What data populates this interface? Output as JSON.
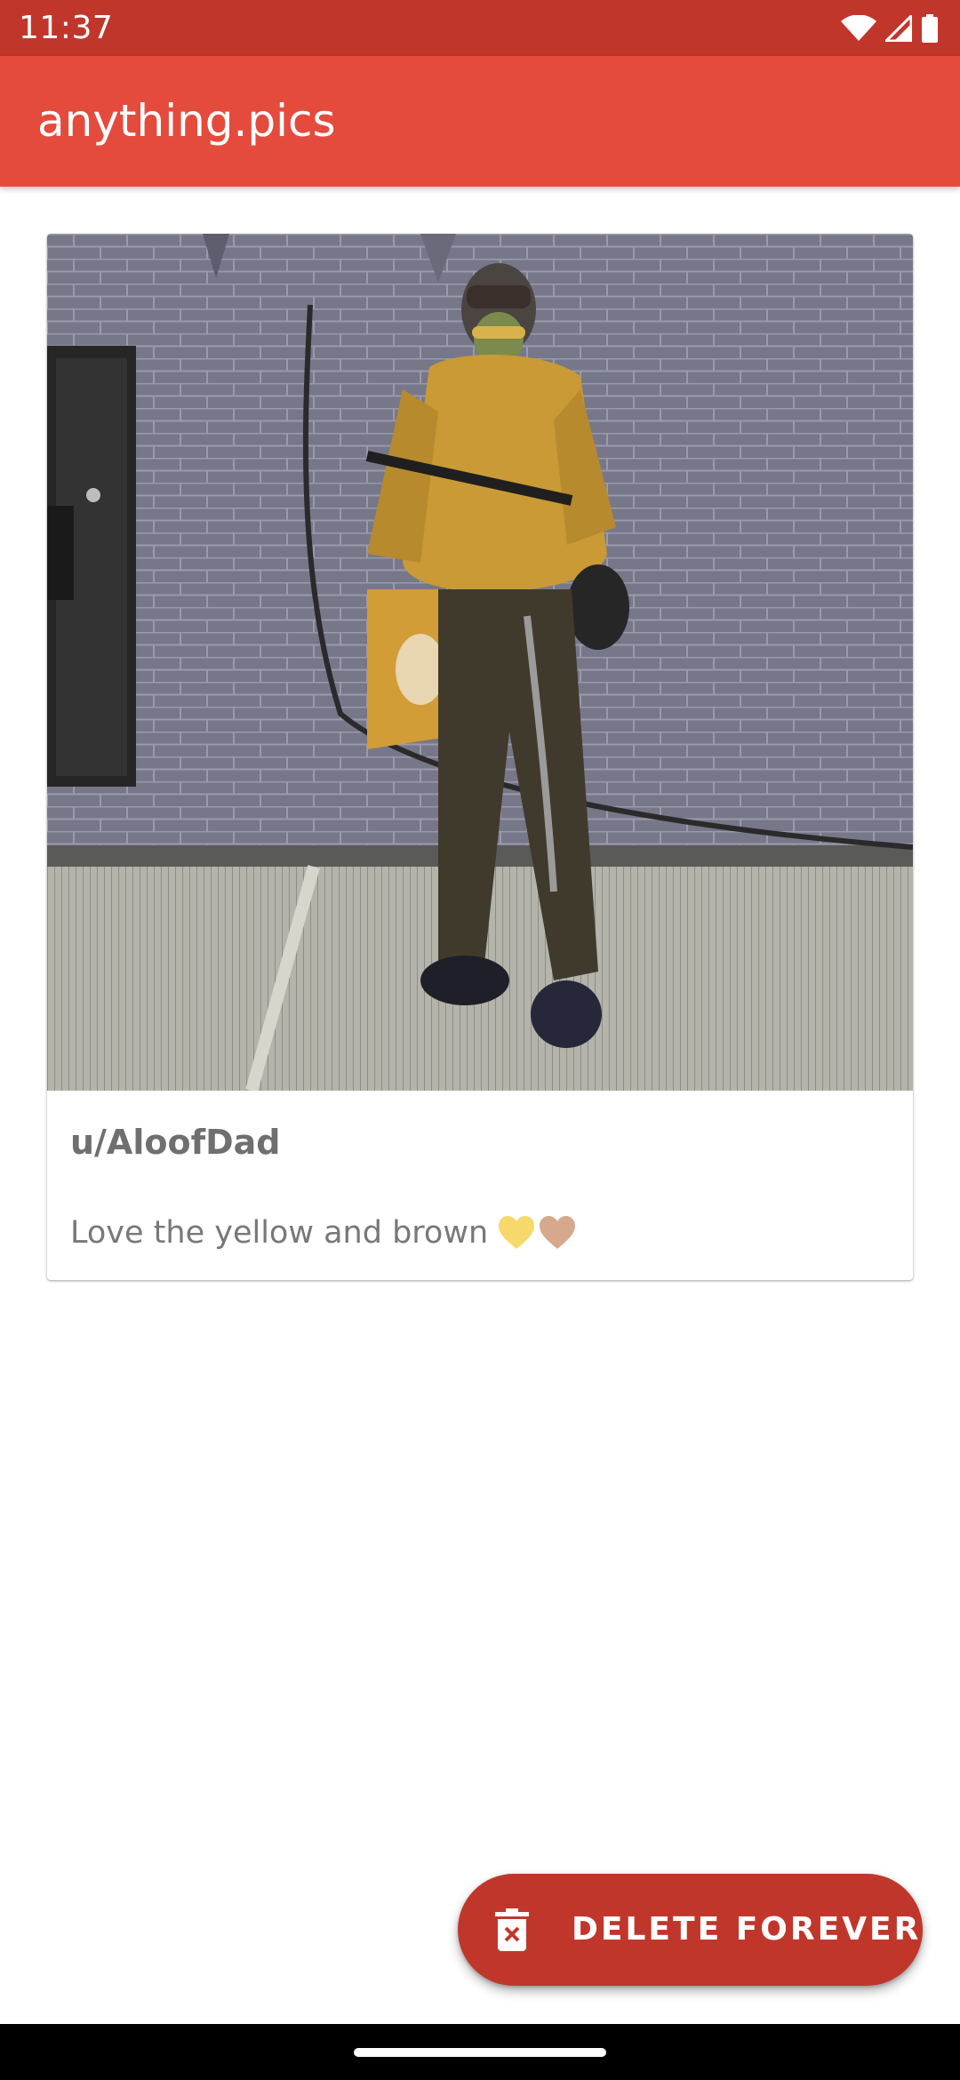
{
  "status_bar": {
    "time": "11:37",
    "icons": [
      "wifi-icon",
      "cell-signal-icon",
      "battery-icon"
    ]
  },
  "app_bar": {
    "title": "anything.pics"
  },
  "post": {
    "username": "u/AloofDad",
    "caption": "Love the yellow and brown",
    "emojis": [
      "yellow-heart-icon",
      "light-brown-heart-icon"
    ]
  },
  "fab": {
    "label": "DELETE FOREVER",
    "icon": "delete-forever-icon"
  },
  "colors": {
    "status_bar": "#c1362b",
    "app_bar": "#e54b3d",
    "fab": "#c1362b",
    "yellow_heart": "#f7d86a",
    "brown_heart": "#d7a98c"
  }
}
